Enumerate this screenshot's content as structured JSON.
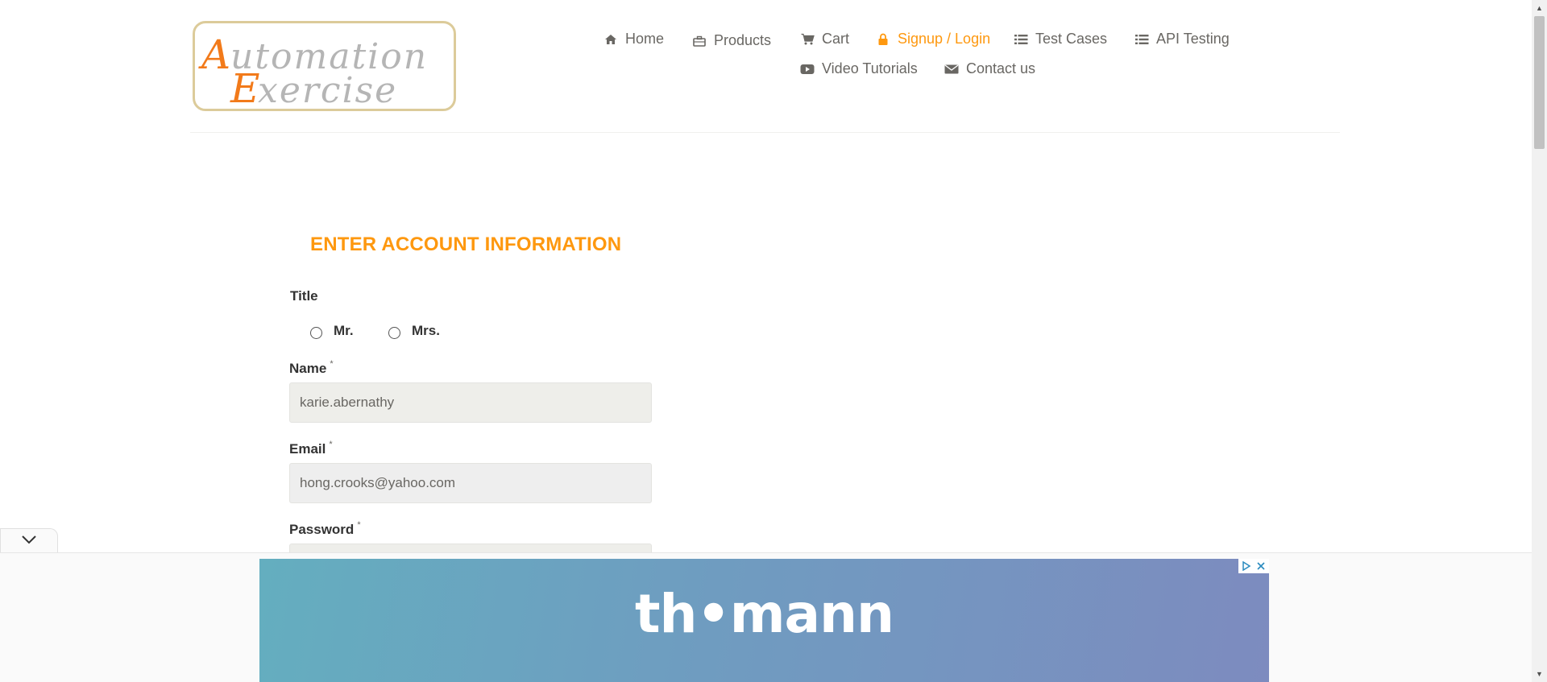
{
  "brand": {
    "logo_line1": "Automation",
    "logo_line2": "Exercise",
    "logo_text": "Automation Exercise",
    "accent_color": "#FE980F",
    "logo_letter_color": "#F27A1A",
    "logo_border_color": "#DCCB9A"
  },
  "nav": {
    "items": [
      {
        "label": "Home",
        "icon": "home-icon"
      },
      {
        "label": "Products",
        "icon": "briefcase-icon"
      },
      {
        "label": "Cart",
        "icon": "cart-icon"
      },
      {
        "label": "Signup / Login",
        "icon": "lock-icon",
        "active": true
      },
      {
        "label": "Test Cases",
        "icon": "list-icon"
      },
      {
        "label": "API Testing",
        "icon": "list-icon"
      },
      {
        "label": "Video Tutorials",
        "icon": "youtube-icon"
      },
      {
        "label": "Contact us",
        "icon": "envelope-icon"
      }
    ]
  },
  "form": {
    "title": "ENTER ACCOUNT INFORMATION",
    "title_label": "Title",
    "title_options": [
      "Mr.",
      "Mrs."
    ],
    "name_label": "Name",
    "name_value": "karie.abernathy",
    "email_label": "Email",
    "email_value": "hong.crooks@yahoo.com",
    "password_label": "Password",
    "required_marker": "*"
  },
  "ad": {
    "brand_text": "th•mann",
    "collapse_icon": "chevron-down-icon",
    "adchoices_icon": "adchoices-icon",
    "close_icon": "close-icon"
  }
}
